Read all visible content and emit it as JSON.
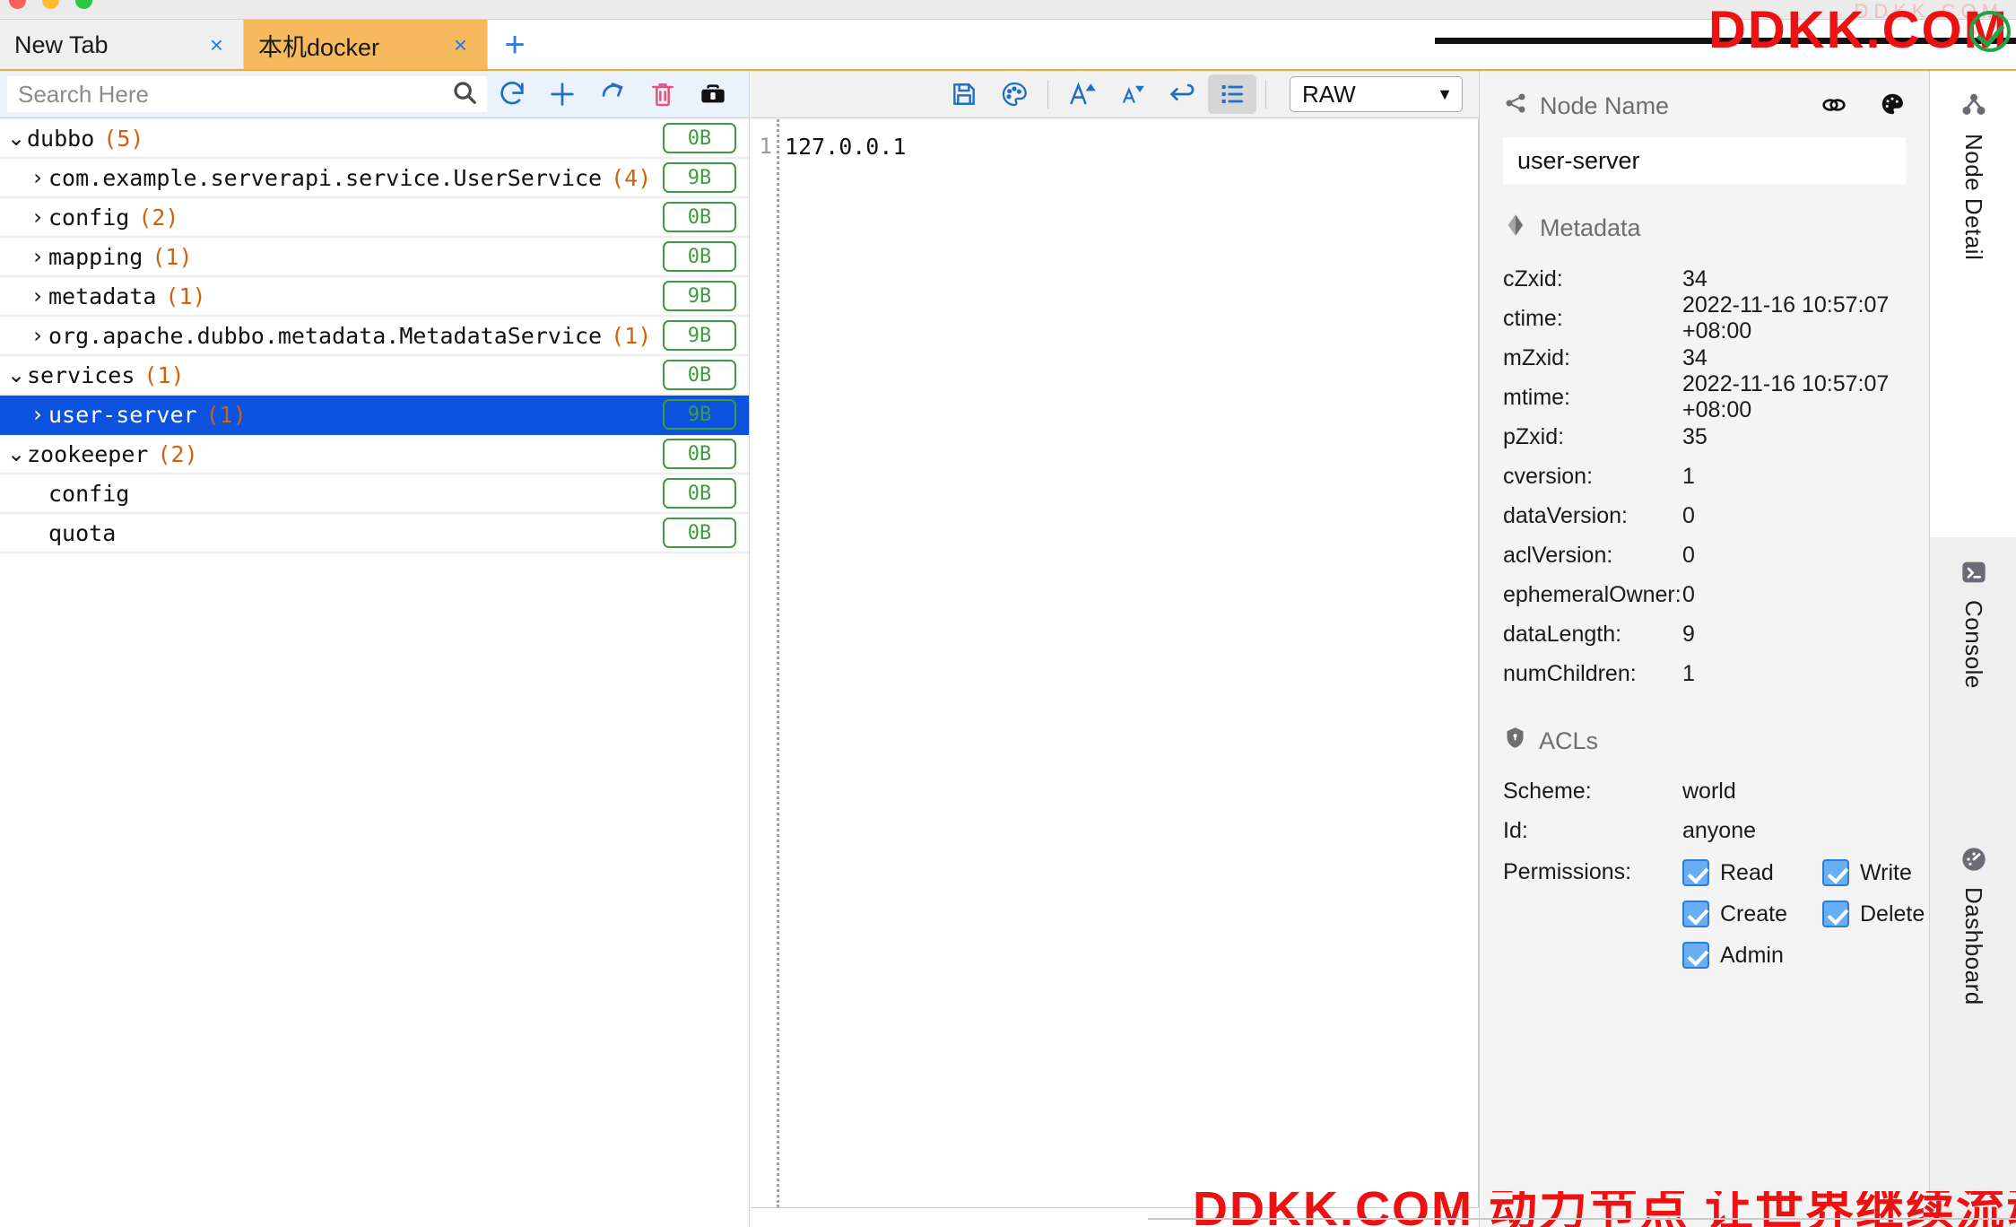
{
  "window": {
    "traffic_lights": [
      "close",
      "minimize",
      "maximize"
    ]
  },
  "tabs": {
    "items": [
      {
        "label": "New Tab",
        "close": "×",
        "active": false
      },
      {
        "label": "本机docker",
        "close": "×",
        "active": true
      }
    ],
    "new_tab_label": "+"
  },
  "left_panel": {
    "search": {
      "placeholder": "Search Here",
      "value": "",
      "icon": "search-icon"
    },
    "toolbar_icons": [
      {
        "name": "refresh-icon",
        "color": "#1f6fc4"
      },
      {
        "name": "add-icon",
        "color": "#1f6fc4"
      },
      {
        "name": "redo-icon",
        "color": "#1f6fc4"
      },
      {
        "name": "delete-icon",
        "color": "#e8527f"
      },
      {
        "name": "toolbox-icon",
        "color": "#111111"
      }
    ],
    "tree": [
      {
        "label": "dubbo",
        "count": "(5)",
        "size": "0B",
        "indent": 0,
        "caret": "⌄",
        "expanded": true,
        "selected": false
      },
      {
        "label": "com.example.serverapi.service.UserService",
        "count": "(4)",
        "size": "9B",
        "indent": 1,
        "caret": "›",
        "expanded": false,
        "selected": false
      },
      {
        "label": "config",
        "count": "(2)",
        "size": "0B",
        "indent": 1,
        "caret": "›",
        "expanded": false,
        "selected": false
      },
      {
        "label": "mapping",
        "count": "(1)",
        "size": "0B",
        "indent": 1,
        "caret": "›",
        "expanded": false,
        "selected": false
      },
      {
        "label": "metadata",
        "count": "(1)",
        "size": "9B",
        "indent": 1,
        "caret": "›",
        "expanded": false,
        "selected": false
      },
      {
        "label": "org.apache.dubbo.metadata.MetadataService",
        "count": "(1)",
        "size": "9B",
        "indent": 1,
        "caret": "›",
        "expanded": false,
        "selected": false
      },
      {
        "label": "services",
        "count": "(1)",
        "size": "0B",
        "indent": 0,
        "caret": "⌄",
        "expanded": true,
        "selected": false
      },
      {
        "label": "user-server",
        "count": "(1)",
        "size": "9B",
        "indent": 1,
        "caret": "›",
        "expanded": false,
        "selected": true
      },
      {
        "label": "zookeeper",
        "count": "(2)",
        "size": "0B",
        "indent": 0,
        "caret": "⌄",
        "expanded": true,
        "selected": false
      },
      {
        "label": "config",
        "count": "",
        "size": "0B",
        "indent": 1,
        "caret": "",
        "expanded": false,
        "selected": false
      },
      {
        "label": "quota",
        "count": "",
        "size": "0B",
        "indent": 1,
        "caret": "",
        "expanded": false,
        "selected": false
      }
    ]
  },
  "editor": {
    "toolbar_icons": [
      {
        "name": "save-icon",
        "active": false
      },
      {
        "name": "palette-icon",
        "active": false
      },
      {
        "name": "font-increase-icon",
        "active": false
      },
      {
        "name": "font-decrease-icon",
        "active": false
      },
      {
        "name": "wrap-line-icon",
        "active": false
      },
      {
        "name": "format-list-icon",
        "active": true
      }
    ],
    "format_select": {
      "value": "RAW",
      "chevron": "▼"
    },
    "line_number": "1",
    "content": "127.0.0.1"
  },
  "node_detail": {
    "node_name_section": {
      "title": "Node Name",
      "icon": "share-nodes-icon",
      "value": "user-server",
      "actions": [
        {
          "name": "link-icon"
        },
        {
          "name": "palette-icon"
        }
      ]
    },
    "metadata_section": {
      "title": "Metadata",
      "icon": "diamond-icon",
      "rows": [
        {
          "key": "cZxid:",
          "value": "34"
        },
        {
          "key": "ctime:",
          "value": "2022-11-16 10:57:07 +08:00"
        },
        {
          "key": "mZxid:",
          "value": "34"
        },
        {
          "key": "mtime:",
          "value": "2022-11-16 10:57:07 +08:00"
        },
        {
          "key": "pZxid:",
          "value": "35"
        },
        {
          "key": "cversion:",
          "value": "1"
        },
        {
          "key": "dataVersion:",
          "value": "0"
        },
        {
          "key": "aclVersion:",
          "value": "0"
        },
        {
          "key": "ephemeralOwner:",
          "value": "0"
        },
        {
          "key": "dataLength:",
          "value": "9"
        },
        {
          "key": "numChildren:",
          "value": "1"
        }
      ]
    },
    "acls_section": {
      "title": "ACLs",
      "icon": "shield-lock-icon",
      "rows": [
        {
          "key": "Scheme:",
          "value": "world"
        },
        {
          "key": "Id:",
          "value": "anyone"
        }
      ],
      "permissions_label": "Permissions:",
      "permissions": [
        {
          "label": "Read",
          "checked": true
        },
        {
          "label": "Write",
          "checked": true
        },
        {
          "label": "Create",
          "checked": true
        },
        {
          "label": "Delete",
          "checked": true
        },
        {
          "label": "Admin",
          "checked": true
        }
      ]
    }
  },
  "side_tabs": [
    {
      "label": "Node Detail",
      "icon": "node-tree-icon",
      "active": true
    },
    {
      "label": "Console",
      "icon": "console-icon",
      "active": false
    },
    {
      "label": "Dashboard",
      "icon": "dashboard-icon",
      "active": false
    }
  ],
  "watermarks": {
    "top_right": "DDKK.COM",
    "bottom": "DDKK.COM 动力节点 让世界继续流动",
    "faint_top": "DDKK.COM"
  },
  "colors": {
    "accent_blue": "#0b52de",
    "tab_active": "#f7b95e",
    "badge_green": "#3d9c3d",
    "count_orange": "#d4600a",
    "toolbar_blue": "#1f6fc4",
    "delete_pink": "#e8527f",
    "watermark_red": "#ee1111"
  }
}
